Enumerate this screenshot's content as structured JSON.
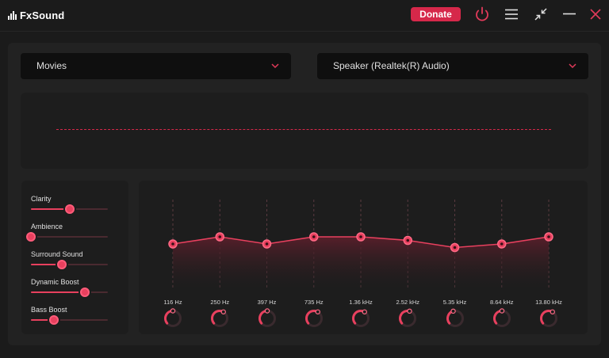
{
  "app": {
    "logo_text": "FxSound",
    "donate_label": "Donate",
    "icons": {
      "power": "power-icon",
      "menu": "hamburger-menu-icon",
      "minimize_view": "collapse-arrows-icon",
      "minimize": "minimize-icon",
      "close": "close-icon"
    },
    "accent_color": "#d6284a"
  },
  "preset": {
    "selected": "Movies"
  },
  "output_device": {
    "selected": "Speaker (Realtek(R) Audio)"
  },
  "effects": [
    {
      "label": "Clarity",
      "value": 0.5
    },
    {
      "label": "Ambience",
      "value": 0.0
    },
    {
      "label": "Surround Sound",
      "value": 0.4
    },
    {
      "label": "Dynamic Boost",
      "value": 0.7
    },
    {
      "label": "Bass Boost",
      "value": 0.3
    }
  ],
  "eq": {
    "bands": [
      {
        "label": "116 Hz",
        "level": 0.0
      },
      {
        "label": "250 Hz",
        "level": 0.5
      },
      {
        "label": "397 Hz",
        "level": 0.0
      },
      {
        "label": "735 Hz",
        "level": 0.5
      },
      {
        "label": "1.36 kHz",
        "level": 0.5
      },
      {
        "label": "2.52 kHz",
        "level": 0.25
      },
      {
        "label": "5.35 kHz",
        "level": -0.25
      },
      {
        "label": "8.64 kHz",
        "level": 0.0
      },
      {
        "label": "13.80 kHz",
        "level": 0.5
      }
    ]
  }
}
